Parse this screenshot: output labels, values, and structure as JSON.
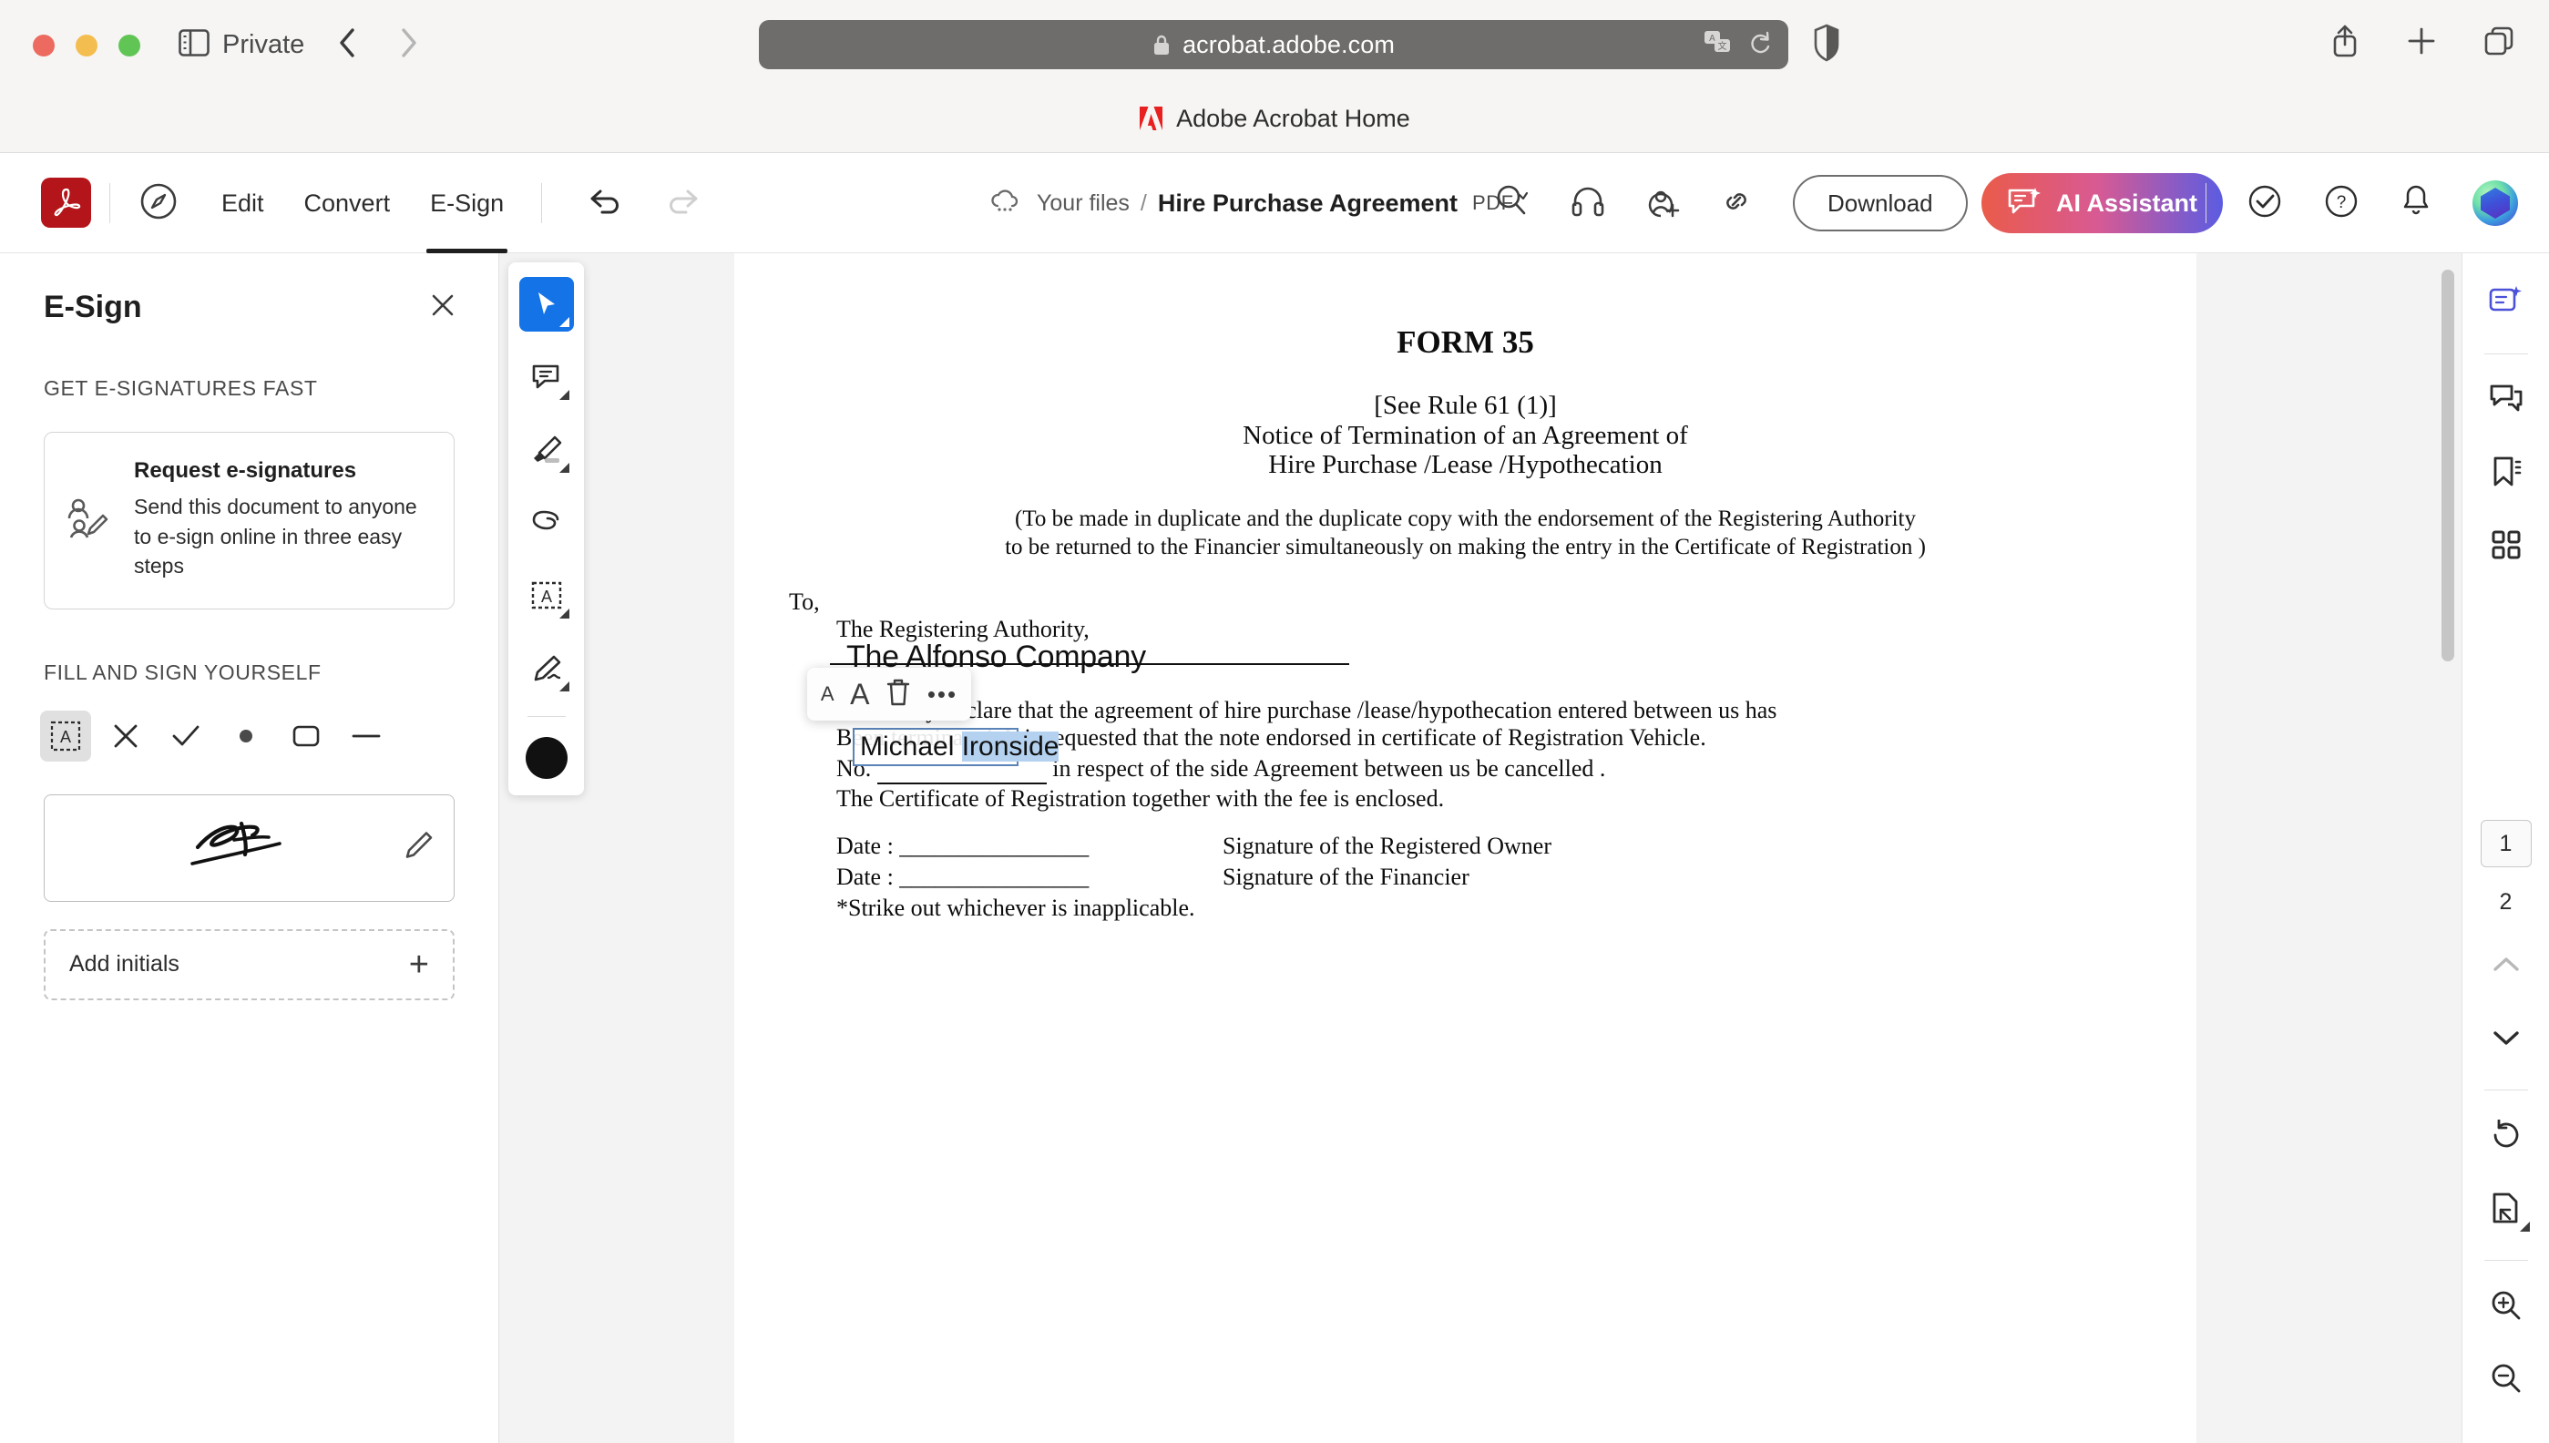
{
  "browser": {
    "profile_label": "Private",
    "url": "acrobat.adobe.com",
    "tab_title": "Adobe Acrobat Home",
    "icons": {
      "sidebar_toggle": "sidebar-toggle-icon",
      "back": "back-chevron-icon",
      "forward": "forward-chevron-icon",
      "lock": "lock-icon",
      "translate": "translate-icon",
      "reload": "reload-icon",
      "shield": "privacy-shield-icon",
      "share": "share-icon",
      "new_tab": "plus-icon",
      "tab_overview": "tab-overview-icon"
    }
  },
  "appbar": {
    "logo": "acrobat-logo",
    "discover_icon": "compass-icon",
    "menus": [
      {
        "label": "Edit",
        "active": false
      },
      {
        "label": "Convert",
        "active": false
      },
      {
        "label": "E-Sign",
        "active": true
      }
    ],
    "undo_icon": "undo-icon",
    "redo_icon": "redo-icon",
    "breadcrumb": {
      "cloud_icon": "cloud-icon",
      "root": "Your files",
      "separator": "/",
      "current": "Hire Purchase Agreement",
      "format_badge": "PDF"
    },
    "tools": {
      "search_icon": "search-icon",
      "listen_icon": "headphones-icon",
      "add_person_icon": "add-person-icon",
      "link_icon": "link-icon",
      "download_label": "Download",
      "more_label": "•••"
    },
    "ai_assistant_label": "AI Assistant",
    "right_icons": {
      "check": "check-circle-icon",
      "help": "help-circle-icon",
      "notifications": "bell-icon",
      "avatar": "user-avatar"
    },
    "colors": {
      "acrobat_red": "#b3151a",
      "ai_gradient_start": "#ea5b4a",
      "ai_gradient_end": "#5b5ce2"
    }
  },
  "esign_panel": {
    "title": "E-Sign",
    "close_icon": "close-icon",
    "section_get": "GET E-SIGNATURES FAST",
    "request_card": {
      "icon": "request-signature-icon",
      "title": "Request e-signatures",
      "description": "Send this document to anyone to e-sign online in three easy steps"
    },
    "section_fill": "FILL AND SIGN YOURSELF",
    "tools": [
      {
        "name": "add-text-tool",
        "glyph": "A",
        "active": true
      },
      {
        "name": "cross-mark-tool",
        "glyph": "✕",
        "active": false
      },
      {
        "name": "check-mark-tool",
        "glyph": "✓",
        "active": false
      },
      {
        "name": "dot-mark-tool",
        "glyph": "●",
        "active": false
      },
      {
        "name": "rectangle-tool",
        "glyph": "▢",
        "active": false
      },
      {
        "name": "line-tool",
        "glyph": "—",
        "active": false
      }
    ],
    "signature_preview_icon": "saved-signature",
    "signature_edit_icon": "pencil-icon",
    "add_initials_label": "Add initials",
    "add_initials_plus": "+"
  },
  "annotation_toolbar": [
    {
      "name": "select-tool",
      "active": true
    },
    {
      "name": "comment-tool",
      "active": false
    },
    {
      "name": "highlight-tool",
      "active": false
    },
    {
      "name": "draw-tool",
      "active": false
    },
    {
      "name": "add-text-tool",
      "active": false
    },
    {
      "name": "signature-tool",
      "active": false
    },
    {
      "name": "color-swatch-black",
      "active": false
    }
  ],
  "context_toolbar": {
    "decrease_font_label": "A",
    "increase_font_label": "A",
    "delete_icon": "trash-icon",
    "more_label": "•••"
  },
  "document": {
    "title": "FORM 35",
    "rule_ref": "[See Rule 61 (1)]",
    "subtitle_line1": "Notice of Termination of an Agreement of",
    "subtitle_line2": "Hire Purchase /Lease /Hypothecation",
    "note_line1": "(To be made in duplicate and the duplicate copy with the endorsement of the Registering Authority",
    "note_line2": "to be returned to the Financier simultaneously on making the entry in the Certificate of Registration )",
    "to_label": "To,",
    "authority_line": "The Registering Authority,",
    "body_line1": "We hereby declare that the agreement of hire purchase /lease/hypothecation entered between us has",
    "body_line2": "Been terminated. It is requested that the note endorsed in certificate of Registration Vehicle.",
    "body_line3_prefix": "No.",
    "body_line3_suffix": "in respect of the side Agreement between us be cancelled .",
    "body_line4": "The Certificate of Registration together with the fee is enclosed.",
    "date_line1": "Date : ________________",
    "date_line2": "Date : ________________",
    "signature_owner": "Signature of the Registered Owner",
    "signature_financier": "Signature of the Financier",
    "footnote": "*Strike out whichever is inapplicable.",
    "filled_fields": {
      "company_name": "The Alfonso Company",
      "active_field_text": "Michael Ironside",
      "active_field_unselected": "Michael ",
      "active_field_selected": "Ironside",
      "selection_color": "#b4d2f0"
    }
  },
  "right_rail": {
    "icons": [
      {
        "name": "ai-summary-icon",
        "accent": "#4b51d8"
      },
      {
        "name": "comments-icon",
        "accent": "#2c2c2c"
      },
      {
        "name": "bookmarks-icon",
        "accent": "#2c2c2c"
      },
      {
        "name": "apps-grid-icon",
        "accent": "#2c2c2c"
      }
    ],
    "pages": [
      {
        "label": "1",
        "active": true
      },
      {
        "label": "2",
        "active": false
      }
    ],
    "nav": {
      "prev_icon": "chevron-up-icon",
      "next_icon": "chevron-down-icon",
      "rotate_icon": "rotate-icon",
      "fit_page_icon": "fit-page-icon",
      "zoom_in_icon": "zoom-in-icon",
      "zoom_out_icon": "zoom-out-icon"
    }
  }
}
